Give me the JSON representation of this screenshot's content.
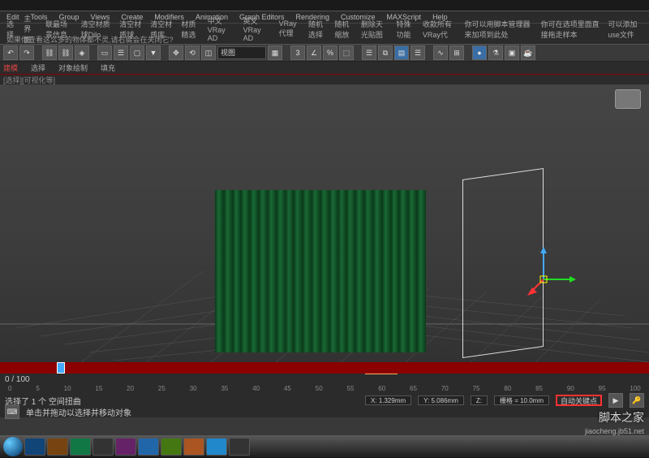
{
  "menus": {
    "m0": "Edit",
    "m1": "Tools",
    "m2": "Group",
    "m3": "Views",
    "m4": "Create",
    "m5": "Modifiers",
    "m6": "Animation",
    "m7": "Graph Editors",
    "m8": "Rendering",
    "m9": "Customize",
    "m10": "MAXScript",
    "m11": "Help"
  },
  "toolbar": {
    "t0": "选择",
    "t1": "主界面",
    "t2": "联最场景信息",
    "t3": "清空材质球Dilo",
    "t4": "清空材质球",
    "t5": "清空材质库",
    "t6": "材质精选",
    "t7": "中文VRay AD",
    "t8": "英文VRay AD",
    "t9": "VRay 代理",
    "t10": "随机选择",
    "t11": "随机缩放",
    "t12": "删除天光贴图",
    "t13": "特殊功能",
    "t14": "收款所有VRay代",
    "t15": "你可以用脚本管理器来加项到此处",
    "t16": "你可在选项里面直接拖走样本",
    "t17": "可以添加use文件"
  },
  "warn": "如果你查看这么多的物体都不灵,请右键会在关闭它?",
  "tabs": {
    "tab0": "建模",
    "tab1": "选择",
    "tab2": "对象绘制",
    "tab3": "填充"
  },
  "subtab": "[选择][可视化等]",
  "dropdown": "视图",
  "frame_range": "0 / 100",
  "status": {
    "sel": "选择了 1 个 空间扭曲",
    "hint": "单击并拖动以选择并移动对象",
    "x": "X: 1.329mm",
    "y": "Y: 5.086mm",
    "z": "Z:",
    "grid": "栅格 = 10.0mm"
  },
  "autokey": "自动关键点",
  "ruler": {
    "r0": "0",
    "r1": "5",
    "r2": "10",
    "r3": "15",
    "r4": "20",
    "r5": "25",
    "r6": "30",
    "r7": "35",
    "r8": "40",
    "r9": "45",
    "r10": "50",
    "r11": "55",
    "r12": "60",
    "r13": "65",
    "r14": "70",
    "r15": "75",
    "r16": "80",
    "r17": "85",
    "r18": "90",
    "r19": "95",
    "r20": "100"
  },
  "watermark": "脚本之家",
  "watermark_url": "jiaocheng.jb51.net"
}
